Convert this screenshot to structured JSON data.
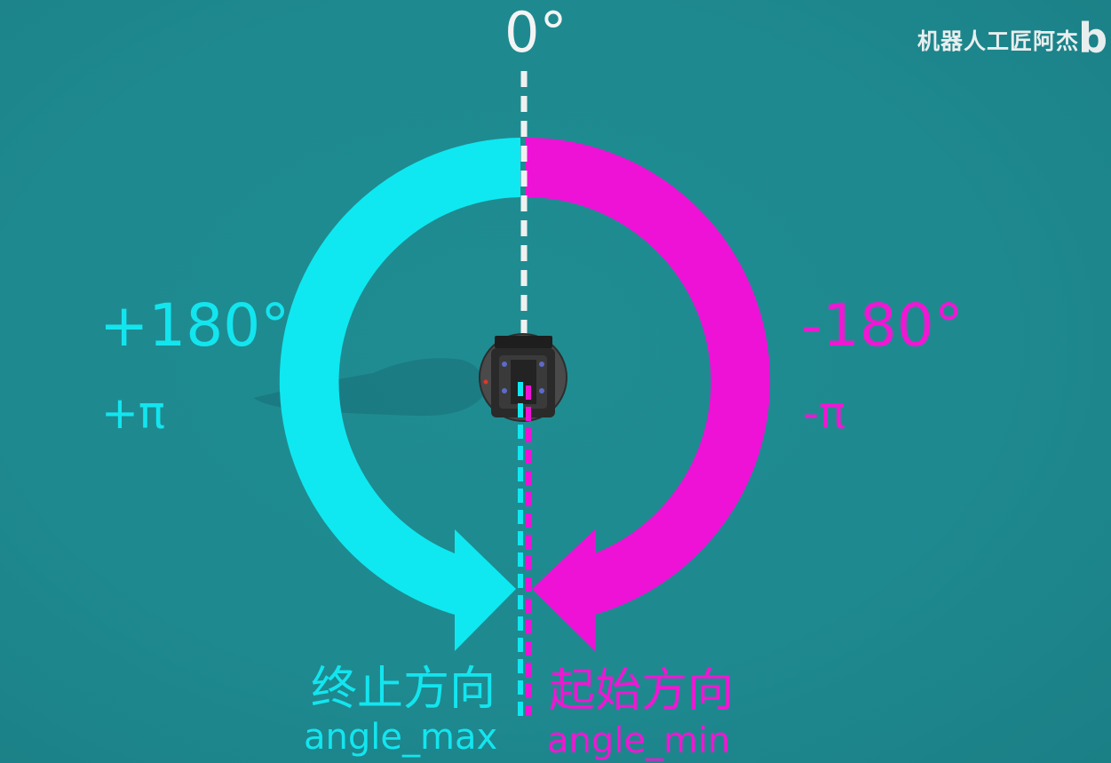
{
  "top_angle": "0°",
  "watermark": "机器人工匠阿杰",
  "watermark_mark": "b",
  "left": {
    "degrees": "+180°",
    "radians": "+π",
    "direction_cn": "终止方向",
    "direction_param": "angle_max"
  },
  "right": {
    "degrees": "-180°",
    "radians": "-π",
    "direction_cn": "起始方向",
    "direction_param": "angle_min"
  },
  "colors": {
    "background": "#1e8a90",
    "left_arc": "#0fe8f0",
    "right_arc": "#ee12d6",
    "zero_line": "#f0f0f0"
  }
}
